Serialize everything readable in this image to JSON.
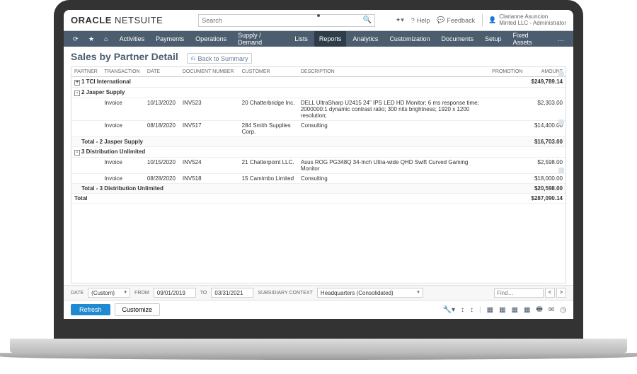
{
  "topbar": {
    "logo_bold": "ORACLE",
    "logo_thin": " NETSUITE",
    "search_placeholder": "Search",
    "help": "Help",
    "feedback": "Feedback",
    "user_name": "Clarianne Asuncion",
    "user_role": "Minted LLC - Administrator"
  },
  "menu": [
    "Activities",
    "Payments",
    "Operations",
    "Supply / Demand",
    "Lists",
    "Reports",
    "Analytics",
    "Customization",
    "Documents",
    "Setup",
    "Fixed Assets",
    "…"
  ],
  "menu_active": 5,
  "page": {
    "title": "Sales by Partner Detail",
    "back": "Back to Summary"
  },
  "columns": [
    "PARTNER",
    "TRANSACTION",
    "DATE",
    "DOCUMENT NUMBER",
    "CUSTOMER",
    "DESCRIPTION",
    "PROMOTION",
    "AMOUNT"
  ],
  "rows": [
    {
      "type": "group",
      "toggle": "+",
      "partner": "1 TCI International",
      "amount": "$249,789.14"
    },
    {
      "type": "group",
      "toggle": "-",
      "partner": "2 Jasper Supply",
      "amount": ""
    },
    {
      "type": "data",
      "txn": "Invoice",
      "date": "10/13/2020",
      "doc": "INV523",
      "cust": "20 Chatterbridge Inc.",
      "desc": "DELL UltraSharp U2415 24\" IPS LED HD Monitor; 6 ms response time; 2000000:1 dynamic contrast ratio; 300 nits brightness; 1920 x 1200 resolution;",
      "amount": "$2,303.00"
    },
    {
      "type": "data",
      "txn": "Invoice",
      "date": "08/18/2020",
      "doc": "INV517",
      "cust": "284 Smith Supplies Corp.",
      "desc": "Consulting",
      "amount": "$14,400.00"
    },
    {
      "type": "subtotal",
      "label": "Total - 2 Jasper Supply",
      "amount": "$16,703.00"
    },
    {
      "type": "group",
      "toggle": "-",
      "partner": "3 Distribution Unlimited",
      "amount": ""
    },
    {
      "type": "data",
      "txn": "Invoice",
      "date": "10/15/2020",
      "doc": "INV524",
      "cust": "21 Chatterpoint LLC.",
      "desc": "Asus ROG PG348Q 34-Inch Ultra-wide QHD Swift Curved Gaming Monitor",
      "amount": "$2,598.00"
    },
    {
      "type": "data",
      "txn": "Invoice",
      "date": "08/28/2020",
      "doc": "INV518",
      "cust": "15 Camimbo Limited",
      "desc": "Consulting",
      "amount": "$18,000.00"
    },
    {
      "type": "subtotal",
      "label": "Total - 3 Distribution Unlimited",
      "amount": "$20,598.00"
    },
    {
      "type": "grand",
      "label": "Total",
      "amount": "$287,090.14"
    }
  ],
  "filters": {
    "date_label": "DATE",
    "date_preset": "(Custom)",
    "from_label": "FROM",
    "from": "09/01/2019",
    "to_label": "TO",
    "to": "03/31/2021",
    "sub_label": "SUBSIDIARY CONTEXT",
    "sub": "Headquarters (Consolidated)",
    "find_placeholder": "Find…"
  },
  "actions": {
    "refresh": "Refresh",
    "customize": "Customize"
  }
}
